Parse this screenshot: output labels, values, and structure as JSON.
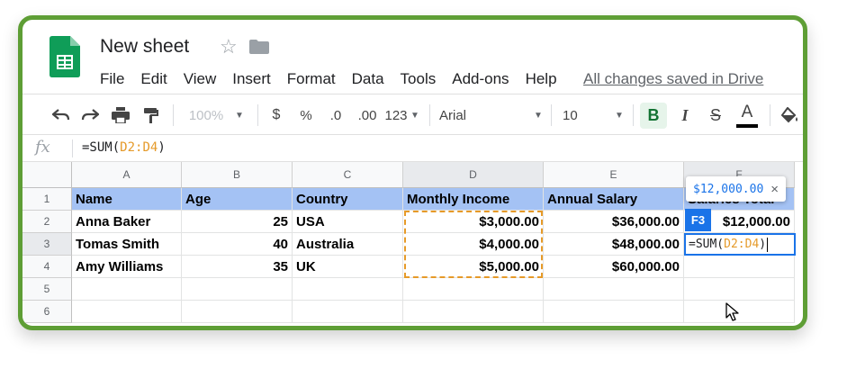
{
  "header": {
    "title": "New sheet",
    "menu": [
      "File",
      "Edit",
      "View",
      "Insert",
      "Format",
      "Data",
      "Tools",
      "Add-ons",
      "Help"
    ],
    "saved_status": "All changes saved in Drive"
  },
  "toolbar": {
    "zoom": "100%",
    "currency": "$",
    "percent": "%",
    "decrease_decimals": ".0",
    "increase_decimals": ".00",
    "more_formats": "123",
    "font_family": "Arial",
    "font_size": "10",
    "bold": "B",
    "italic": "I",
    "strikethrough": "S",
    "text_color": "A"
  },
  "formula_bar": {
    "fx": "fx",
    "prefix": "=SUM(",
    "range": "D2:D4",
    "suffix": ")"
  },
  "columns": [
    "A",
    "B",
    "C",
    "D",
    "E",
    "F"
  ],
  "rows": [
    "1",
    "2",
    "3",
    "4",
    "5",
    "6"
  ],
  "table": {
    "headers": [
      "Name",
      "Age",
      "Country",
      "Monthly Income",
      "Annual Salary",
      "Salaries Total"
    ],
    "data": [
      [
        "Anna Baker",
        "25",
        "USA",
        "$3,000.00",
        "$36,000.00",
        "$12,000.00"
      ],
      [
        "Tomas Smith",
        "40",
        "Australia",
        "$4,000.00",
        "$48,000.00",
        ""
      ],
      [
        "Amy Williams",
        "35",
        "UK",
        "$5,000.00",
        "$60,000.00",
        ""
      ]
    ]
  },
  "active_cell": {
    "label": "F3",
    "prefix": "=SUM(",
    "range": "D2:D4",
    "suffix": ")"
  },
  "tooltip": {
    "value": "$12,000.00",
    "close": "×"
  },
  "colors": {
    "frame": "#5e9e35",
    "header_fill": "#a4c2f4",
    "range_highlight": "#e69a28",
    "selection": "#1a73e8"
  }
}
